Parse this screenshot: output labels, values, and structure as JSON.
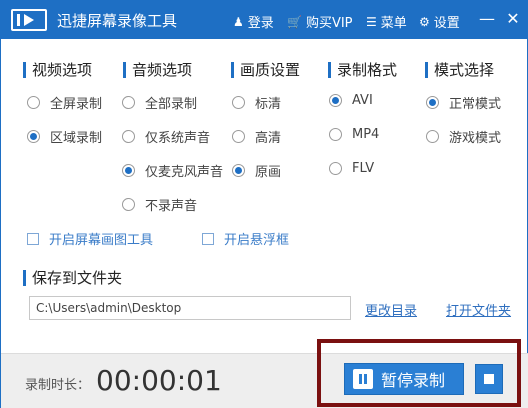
{
  "titlebar": {
    "app_title": "迅捷屏幕录像工具",
    "login": "登录",
    "buy_vip": "购买VIP",
    "menu": "菜单",
    "settings": "设置",
    "minimize": "—",
    "close": "✕"
  },
  "groups": {
    "video": {
      "title": "视频选项",
      "options": [
        {
          "label": "全屏录制",
          "selected": false
        },
        {
          "label": "区域录制",
          "selected": true
        }
      ]
    },
    "audio": {
      "title": "音频选项",
      "options": [
        {
          "label": "全部录制",
          "selected": false
        },
        {
          "label": "仅系统声音",
          "selected": false
        },
        {
          "label": "仅麦克风声音",
          "selected": true
        },
        {
          "label": "不录声音",
          "selected": false
        }
      ]
    },
    "quality": {
      "title": "画质设置",
      "options": [
        {
          "label": "标清",
          "selected": false
        },
        {
          "label": "高清",
          "selected": false
        },
        {
          "label": "原画",
          "selected": true
        }
      ]
    },
    "format": {
      "title": "录制格式",
      "options": [
        {
          "label": "AVI",
          "selected": true
        },
        {
          "label": "MP4",
          "selected": false
        },
        {
          "label": "FLV",
          "selected": false
        }
      ]
    },
    "mode": {
      "title": "模式选择",
      "options": [
        {
          "label": "正常模式",
          "selected": true
        },
        {
          "label": "游戏模式",
          "selected": false
        }
      ]
    }
  },
  "checkboxes": {
    "drawing_tool": {
      "label": "开启屏幕画图工具",
      "checked": false
    },
    "floating_window": {
      "label": "开启悬浮框",
      "checked": false
    }
  },
  "save": {
    "title": "保存到文件夹",
    "path": "C:\\Users\\admin\\Desktop",
    "change_dir": "更改目录",
    "open_folder": "打开文件夹"
  },
  "bottom": {
    "duration_label": "录制时长：",
    "duration_value": "00:00:01",
    "pause_label": "暂停录制"
  },
  "colors": {
    "accent": "#1e6fc4",
    "highlight_border": "#7a1010"
  }
}
